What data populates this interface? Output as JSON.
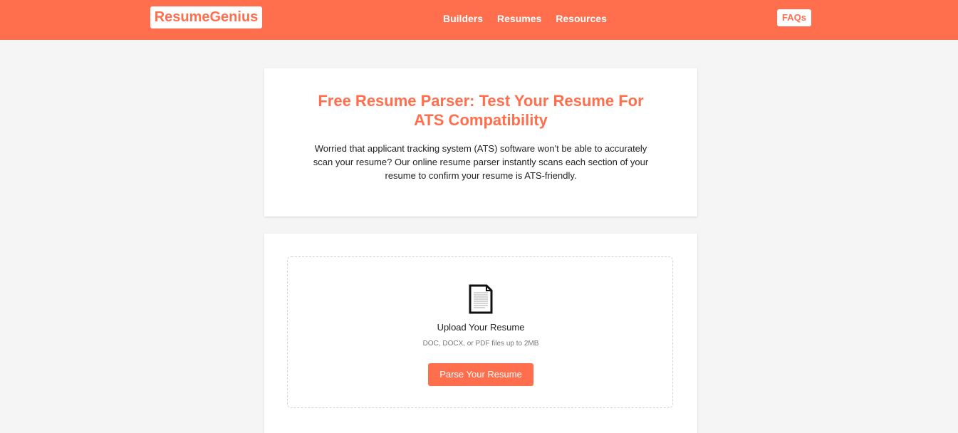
{
  "header": {
    "logo_text": "ResumeGenius",
    "nav": [
      "Builders",
      "Resumes",
      "Resources"
    ],
    "faq_label": "FAQs"
  },
  "intro": {
    "title": "Free Resume Parser: Test Your Resume For ATS Compatibility",
    "description": "Worried that applicant tracking system (ATS) software won't be able to accurately scan your resume? Our online resume parser instantly scans each section of your resume to confirm your resume is ATS-friendly."
  },
  "upload": {
    "icon": "document-icon",
    "title": "Upload Your Resume",
    "hint": "DOC, DOCX, or PDF files up to 2MB",
    "button_label": "Parse Your Resume"
  },
  "colors": {
    "brand": "#ff6f4e",
    "background": "#f5f5f5"
  }
}
